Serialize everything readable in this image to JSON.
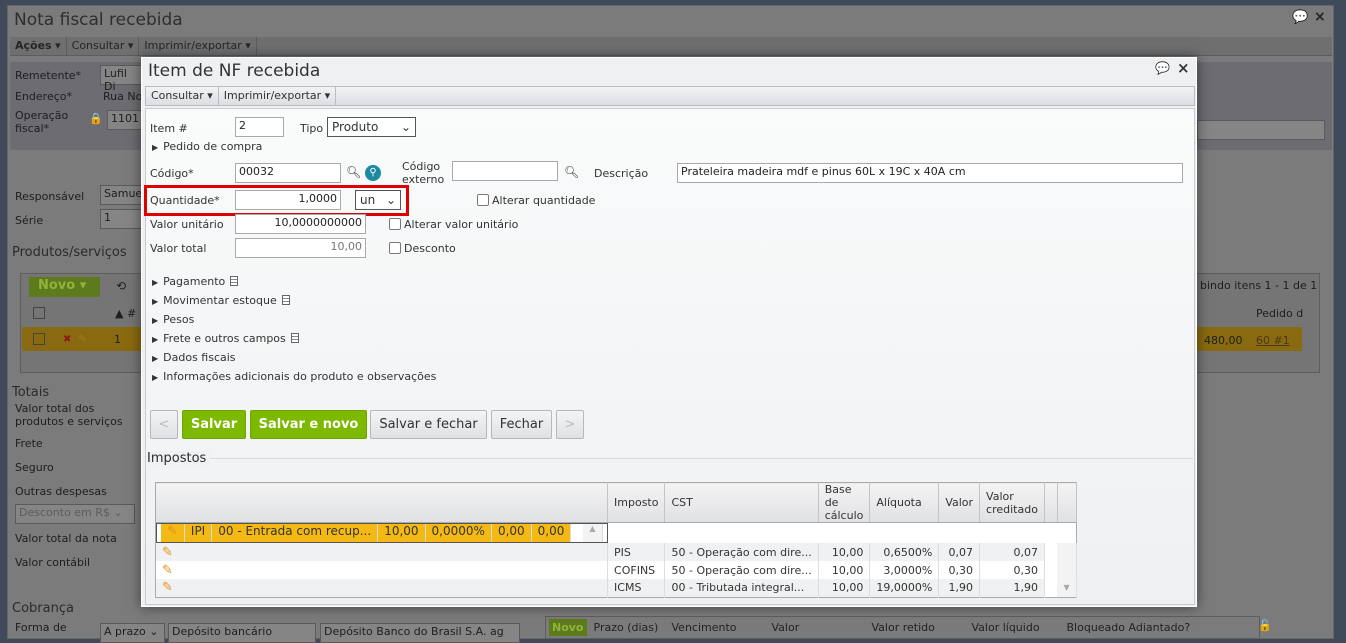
{
  "parent": {
    "title": "Nota fiscal recebida",
    "menu": [
      "Ações",
      "Consultar",
      "Imprimir/exportar"
    ],
    "fields": {
      "remetente_label": "Remetente*",
      "remetente_value": "Lufil Di",
      "endereco_label": "Endereço*",
      "endereco_value": "Rua No",
      "operacao_label": "Operação fiscal*",
      "operacao_value": "1101",
      "responsavel_label": "Responsável",
      "responsavel_value": "Samue",
      "serie_label": "Série",
      "serie_value": "1"
    },
    "produtos": {
      "title": "Produtos/serviços",
      "novo": "Novo",
      "pager": "bindo itens 1 - 1 de 1",
      "col_num": "#",
      "col_pedido": "Pedido d",
      "row_num": "1",
      "row_value": "480,00",
      "row_pedido": "60 #1"
    },
    "totais": {
      "title": "Totais",
      "labels": [
        "Valor total dos produtos e serviços",
        "Frete",
        "Seguro",
        "Outras despesas"
      ],
      "desconto_select": "Desconto em R$",
      "total_nota": "Valor total da nota",
      "valor_contabil": "Valor contábil"
    },
    "cobranca": {
      "title": "Cobrança",
      "forma_label": "Forma de",
      "prazo": "A prazo",
      "deposito": "Depósito bancário",
      "banco": "Depósito Banco do Brasil S.A. ag",
      "novo": "Novo",
      "columns": [
        "Prazo (dias)",
        "Vencimento",
        "Valor",
        "Valor retido",
        "Valor líquido",
        "Bloqueado",
        "Adiantado?"
      ]
    }
  },
  "modal": {
    "title": "Item de NF recebida",
    "menu": [
      "Consultar",
      "Imprimir/exportar"
    ],
    "item_label": "Item #",
    "item_value": "2",
    "tipo_label": "Tipo",
    "tipo_value": "Produto",
    "pedido_compra": "Pedido de compra",
    "codigo_label": "Código*",
    "codigo_value": "00032",
    "codigo_externo_label": "Código externo",
    "codigo_externo_value": "",
    "descricao_label": "Descrição",
    "descricao_value": "Prateleira madeira mdf e pinus 60L x 19C x 40A cm",
    "quantidade_label": "Quantidade*",
    "quantidade_value": "1,0000",
    "unidade_value": "un",
    "alterar_quantidade": "Alterar quantidade",
    "valor_unitario_label": "Valor unitário",
    "valor_unitario_value": "10,0000000000",
    "alterar_valor_unitario": "Alterar valor unitário",
    "valor_total_label": "Valor total",
    "valor_total_value": "10,00",
    "desconto": "Desconto",
    "sections": [
      "Pagamento",
      "Movimentar estoque",
      "Pesos",
      "Frete e outros campos",
      "Dados fiscais",
      "Informações adicionais do produto e observações"
    ],
    "buttons": {
      "prev": "<",
      "salvar": "Salvar",
      "salvar_novo": "Salvar e novo",
      "salvar_fechar": "Salvar e fechar",
      "fechar": "Fechar",
      "next": ">"
    },
    "impostos": {
      "title": "Impostos",
      "columns": [
        "Imposto",
        "CST",
        "Base de cálculo",
        "Alíquota",
        "Valor",
        "Valor creditado"
      ],
      "rows": [
        [
          "IPI",
          "00 - Entrada com recup...",
          "10,00",
          "0,0000%",
          "0,00",
          "0,00"
        ],
        [
          "PIS",
          "50 - Operação com dire...",
          "10,00",
          "0,6500%",
          "0,07",
          "0,07"
        ],
        [
          "COFINS",
          "50 - Operação com dire...",
          "10,00",
          "3,0000%",
          "0,30",
          "0,30"
        ],
        [
          "ICMS",
          "00 - Tributada integral...",
          "10,00",
          "19,0000%",
          "1,90",
          "1,90"
        ]
      ]
    }
  },
  "colors": {
    "accent_green": "#7cb900",
    "selected_row": "#f4b914",
    "highlight_box": "#e00000"
  }
}
